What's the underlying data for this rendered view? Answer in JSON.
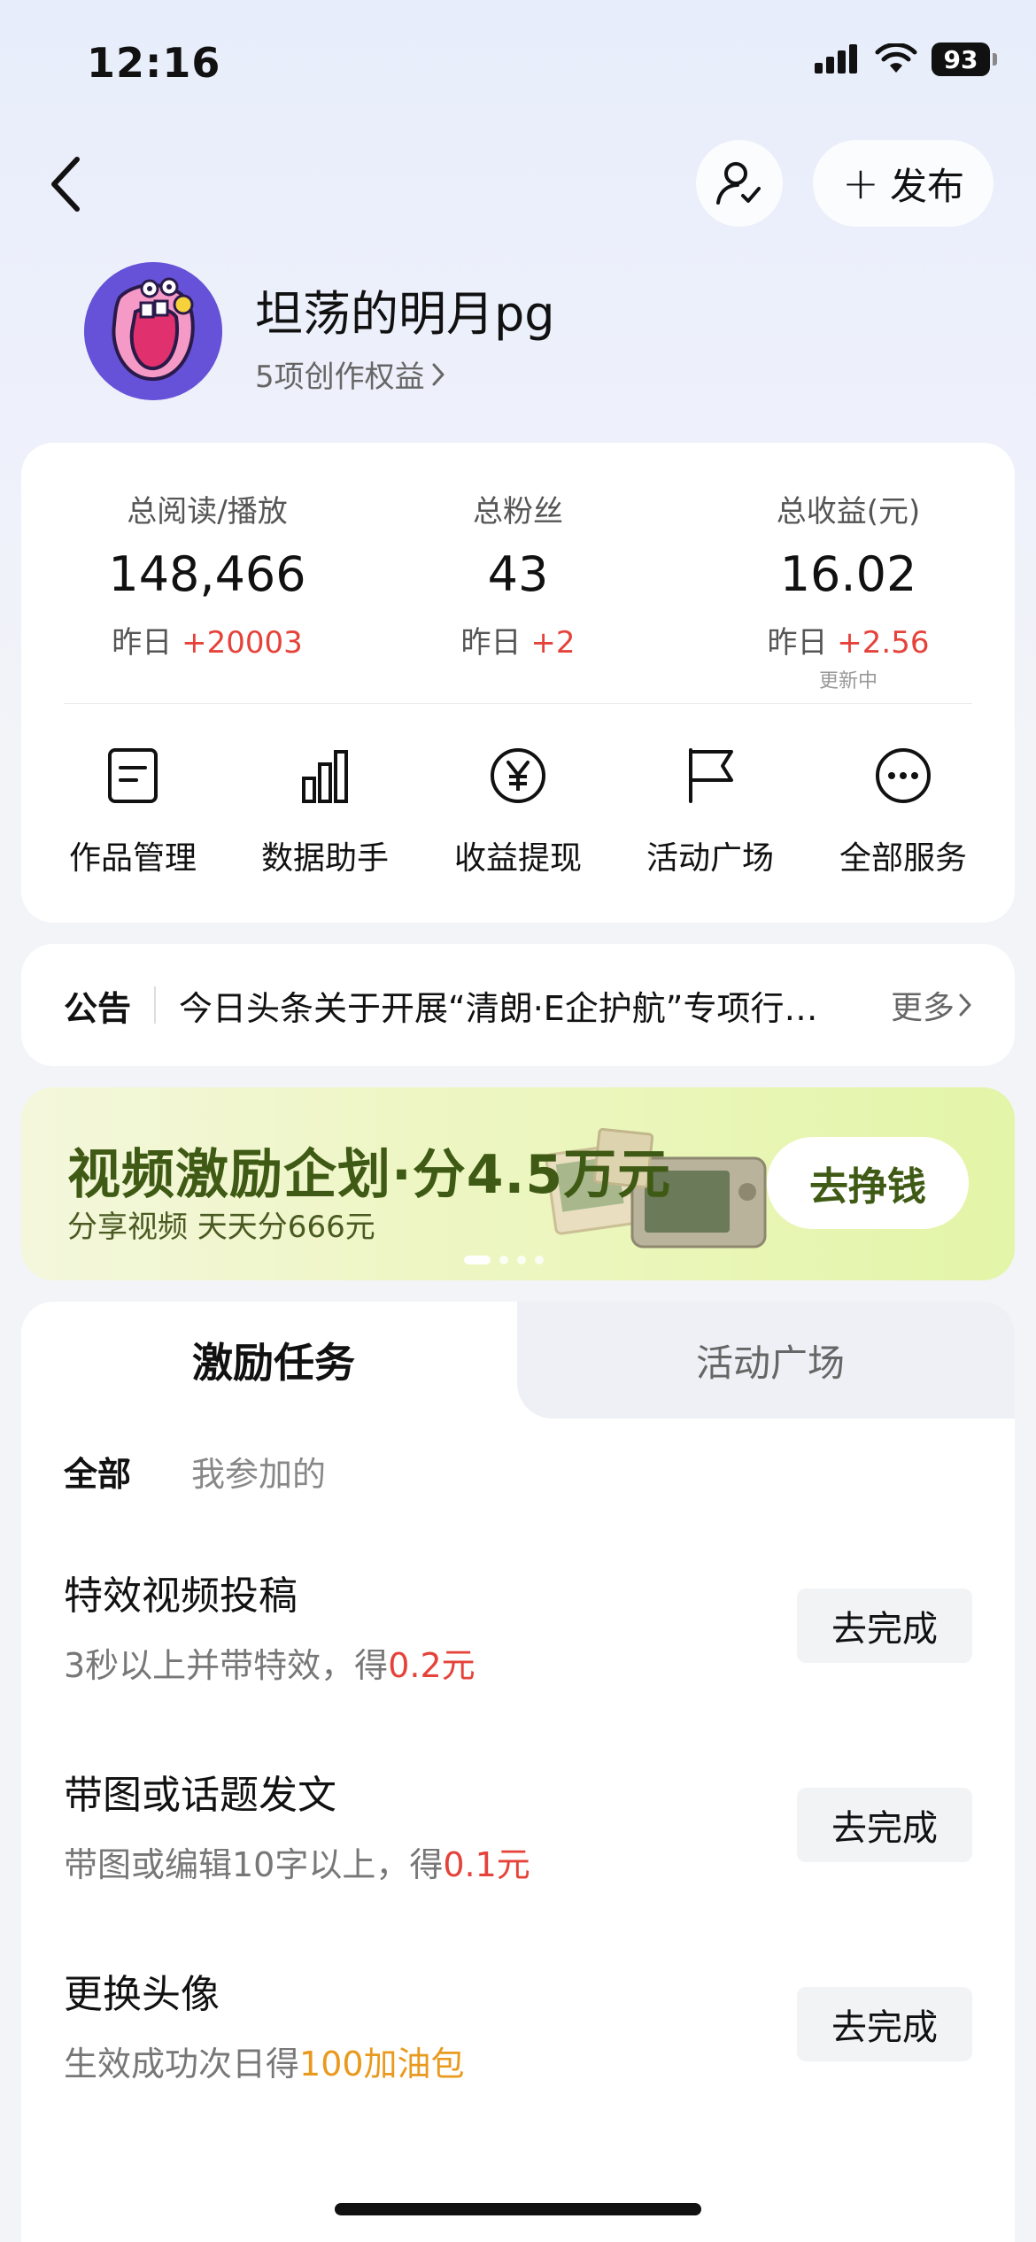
{
  "status_bar": {
    "time": "12:16",
    "battery": "93"
  },
  "profile": {
    "username": "坦荡的明月pg",
    "rights": "5项创作权益",
    "publish_label": "发布"
  },
  "stats": [
    {
      "label": "总阅读/播放",
      "value": "148,466",
      "yesterday_label": "昨日",
      "yesterday_delta": "+20003",
      "note": ""
    },
    {
      "label": "总粉丝",
      "value": "43",
      "yesterday_label": "昨日",
      "yesterday_delta": "+2",
      "note": ""
    },
    {
      "label": "总收益(元)",
      "value": "16.02",
      "yesterday_label": "昨日",
      "yesterday_delta": "+2.56",
      "note": "更新中"
    }
  ],
  "services": [
    {
      "label": "作品管理",
      "icon": "document-icon"
    },
    {
      "label": "数据助手",
      "icon": "bar-chart-icon"
    },
    {
      "label": "收益提现",
      "icon": "yen-icon"
    },
    {
      "label": "活动广场",
      "icon": "flag-icon"
    },
    {
      "label": "全部服务",
      "icon": "more-icon"
    }
  ],
  "notice": {
    "title": "公告",
    "text": "今日头条关于开展“清朗·E企护航”专项行动的公告",
    "more": "更多"
  },
  "banner": {
    "title": "视频激励企划·分4.5万元",
    "subtitle": "分享视频 天天分666元",
    "button": "去挣钱",
    "page_count": 4,
    "active_page": 1
  },
  "tabs": {
    "active": "激励任务",
    "inactive": "活动广场"
  },
  "filters": {
    "all": "全部",
    "mine": "我参加的"
  },
  "tasks": [
    {
      "title": "特效视频投稿",
      "desc_prefix": "3秒以上并带特效，得",
      "reward": "0.2元",
      "button": "去完成"
    },
    {
      "title": "带图或话题发文",
      "desc_prefix": "带图或编辑10字以上，得",
      "reward": "0.1元",
      "button": "去完成"
    },
    {
      "title": "更换头像",
      "desc_prefix": "生效成功次日得",
      "reward": "100加油包",
      "button": "去完成"
    }
  ],
  "colors": {
    "accent_red": "#e5423a",
    "reward_orange": "#e99a1e",
    "banner_green": "#3f5a14"
  }
}
